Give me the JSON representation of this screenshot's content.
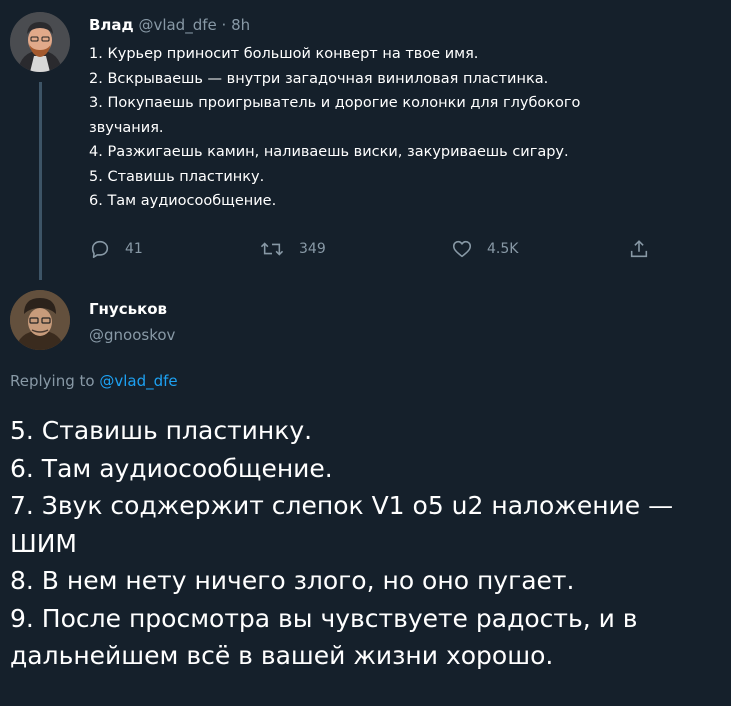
{
  "tweet": {
    "author_name": "Влад",
    "author_handle": "@vlad_dfe",
    "separator": "·",
    "time": "8h",
    "lines": [
      "1. Курьер приносит большой конверт на твое имя.",
      "2. Вскрываешь — внутри загадочная виниловая пластинка.",
      "3. Покупаешь проигрыватель и дорогие колонки для глубокого",
      "звучания.",
      "4. Разжигаешь камин, наливаешь виски, закуриваешь сигару.",
      "5. Ставишь пластинку.",
      "6. Там аудиосообщение."
    ],
    "actions": {
      "reply_count": "41",
      "retweet_count": "349",
      "like_count": "4.5K"
    }
  },
  "reply": {
    "author_name": "Гнуськов",
    "author_handle": "@gnooskov",
    "replying_prefix": "Replying to",
    "replying_to": "@vlad_dfe",
    "lines": [
      "5. Ставишь пластинку.",
      "6. Там аудиосообщение.",
      "7. Звук соджержит слепок V1 о5 u2 наложение —",
      "ШИМ",
      "8. В нем нету ничего злого, но оно пугает.",
      "9. После просмотра вы чувствуете радость, и в",
      "дальнейшем всё в вашей жизни хорошо."
    ]
  },
  "colors": {
    "background": "#15202b",
    "text": "#ffffff",
    "muted": "#8899a6",
    "link": "#1da1f2",
    "thread_line": "#3d5466"
  },
  "icons": [
    "reply-icon",
    "retweet-icon",
    "like-icon",
    "share-icon"
  ]
}
